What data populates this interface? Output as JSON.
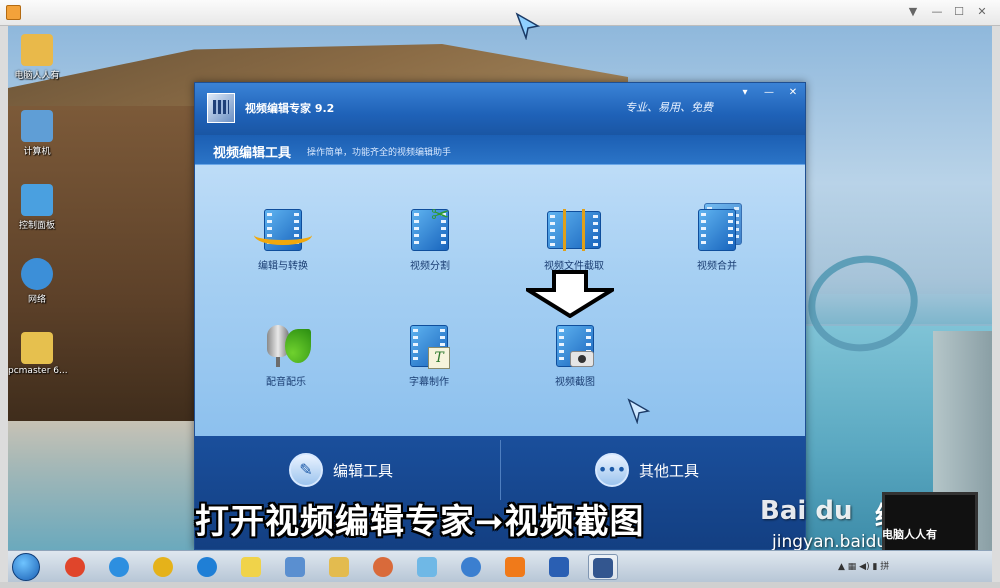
{
  "viewer": {
    "controls": [
      "▼",
      "—",
      "☐",
      "✕"
    ]
  },
  "desktop": {
    "icons": [
      {
        "label": "电脑人人有",
        "icon": "user-folder-icon",
        "color": "#e9b94a"
      },
      {
        "label": "计算机",
        "icon": "computer-icon",
        "color": "#5f9ed6"
      },
      {
        "label": "控制面板",
        "icon": "control-panel-icon",
        "color": "#4aa0e0"
      },
      {
        "label": "网络",
        "icon": "network-globe-icon",
        "color": "#3c8fd8"
      },
      {
        "label": "pcmaster 6...",
        "icon": "folder-icon",
        "color": "#e6c04e"
      }
    ]
  },
  "app": {
    "title": "视频编辑专家 9.2",
    "slogan": "专业、易用、免费",
    "window_controls": [
      "▾",
      "—",
      "✕"
    ],
    "header_title": "视频编辑工具",
    "header_desc": "操作简单，功能齐全的视频编辑助手",
    "tools": [
      {
        "label": "编辑与转换",
        "icon": "edit-convert-icon"
      },
      {
        "label": "视频分割",
        "icon": "video-split-icon"
      },
      {
        "label": "视频文件截取",
        "icon": "video-clip-icon"
      },
      {
        "label": "视频合并",
        "icon": "video-merge-icon"
      },
      {
        "label": "配音配乐",
        "icon": "dubbing-music-icon"
      },
      {
        "label": "字幕制作",
        "icon": "subtitle-icon"
      },
      {
        "label": "视频截图",
        "icon": "video-screenshot-icon"
      }
    ],
    "footer_tabs": [
      {
        "label": "编辑工具",
        "icon": "pencil-icon"
      },
      {
        "label": "其他工具",
        "icon": "more-dots-icon"
      }
    ]
  },
  "caption": "打开视频编辑专家➞视频截图",
  "watermark": {
    "brand": "Bai du",
    "jingyan": "经验",
    "url": "jingyan.baidu.com",
    "laptop_text": "电脑人人有"
  },
  "taskbar": {
    "apps": [
      {
        "icon": "red-app-icon",
        "color": "#e0452b"
      },
      {
        "icon": "ie-browser-icon",
        "color": "#2d8fe0"
      },
      {
        "icon": "chrome-browser-icon",
        "color": "#e5b21a"
      },
      {
        "icon": "blue-q-app-icon",
        "color": "#1f7fd6"
      },
      {
        "icon": "notes-app-icon",
        "color": "#f0d34a"
      },
      {
        "icon": "network-center-icon",
        "color": "#5a8fd0"
      },
      {
        "icon": "file-explorer-icon",
        "color": "#e3bb4f"
      },
      {
        "icon": "settings-flower-icon",
        "color": "#d96a3a"
      },
      {
        "icon": "paint-app-icon",
        "color": "#6fb8e6"
      },
      {
        "icon": "video-player-icon",
        "color": "#3b7fd0"
      },
      {
        "icon": "media-player-icon",
        "color": "#f07a1a"
      },
      {
        "icon": "metro-app-icon",
        "color": "#2a5fb3"
      },
      {
        "icon": "video-editor-icon",
        "color": "#33568f"
      }
    ],
    "tray": "▲ ▦ ◀) ▮ 拼"
  }
}
